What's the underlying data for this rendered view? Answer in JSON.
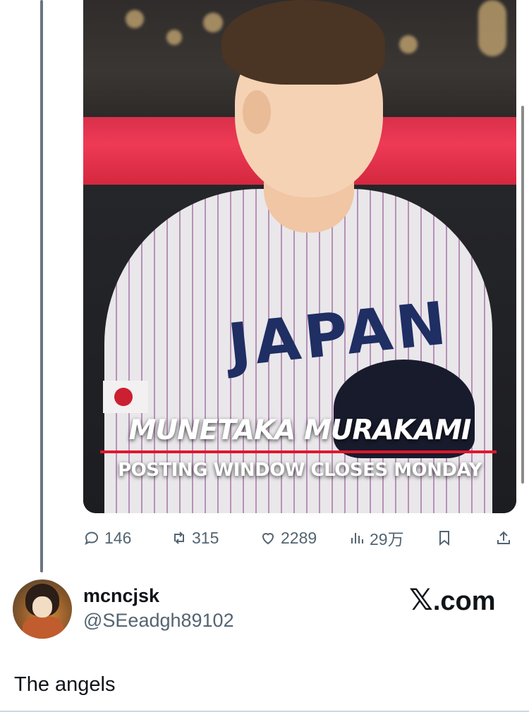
{
  "media": {
    "headline": "MUNETAKA MURAKAMI",
    "subhead": "POSTING WINDOW CLOSES MONDAY",
    "jersey_text": "JAPAN"
  },
  "actions": {
    "replies": "146",
    "reposts": "315",
    "likes": "2289",
    "views": "29万"
  },
  "reply": {
    "display_name": "mcncjsk",
    "handle": "@SEeadgh89102",
    "text": "The angels"
  },
  "brand": {
    "x_symbol": "𝕏",
    "suffix": ".com"
  },
  "colors": {
    "text_primary": "#0f1419",
    "text_secondary": "#536471",
    "headline_rule": "#e2162b",
    "thread_line": "#6b7480"
  }
}
